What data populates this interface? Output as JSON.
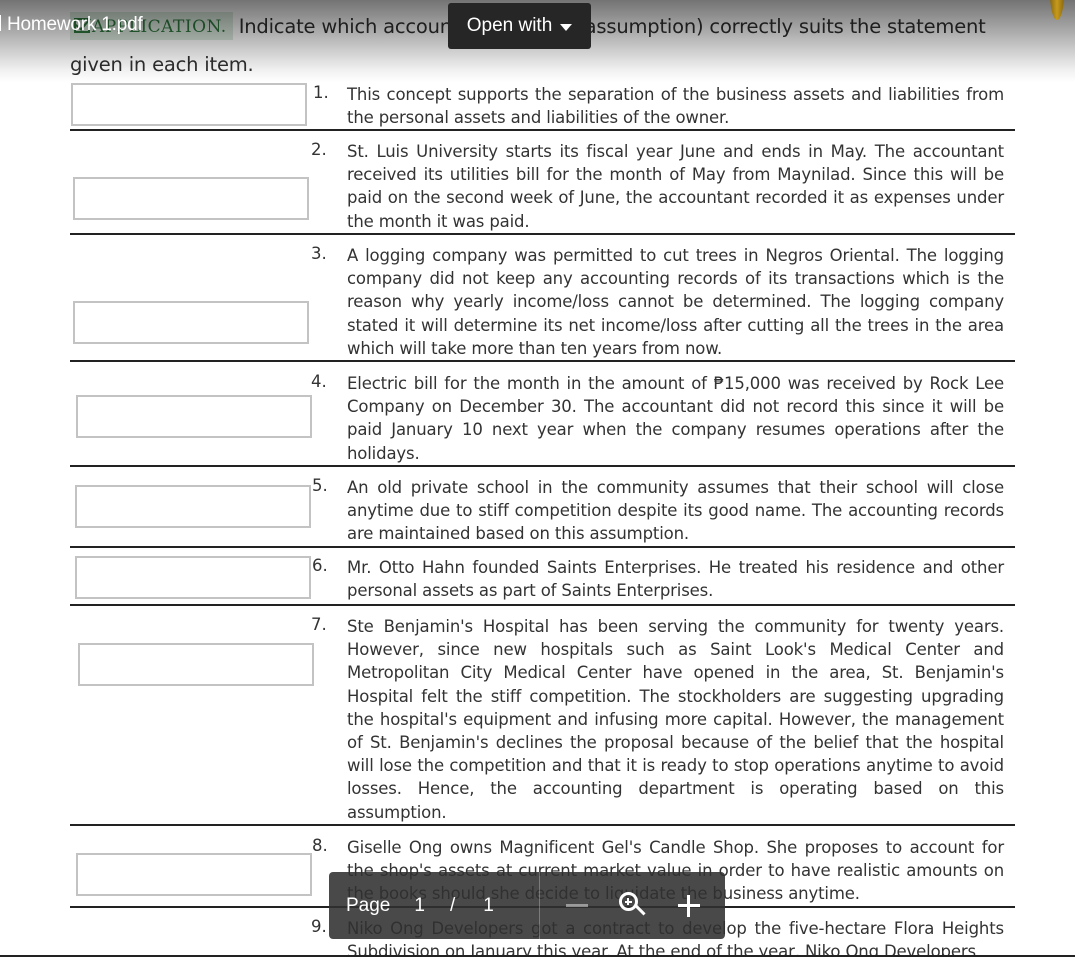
{
  "viewer": {
    "file_title": "Homework 1.pdf",
    "open_with_label": "Open with",
    "toolbar": {
      "page_label": "Page",
      "current_page": "1",
      "separator": "/",
      "total_pages": "1"
    }
  },
  "document": {
    "section_label": "APPLICATION.",
    "instructions_line1": "Indicate which accounting principle(assumption) correctly suits the statement",
    "instructions_line2": "given in each item.",
    "items": [
      {
        "number": "1.",
        "answer": "",
        "text": "This concept supports the separation of the business assets and liabilities from the personal assets and liabilities of the owner."
      },
      {
        "number": "2.",
        "answer": "",
        "text": "St. Luis University starts its fiscal year June and ends in May. The accountant received its utilities bill for the month of May from Maynilad. Since this will be paid on the second week of June, the accountant recorded it as expenses under the month it was paid."
      },
      {
        "number": "3.",
        "answer": "",
        "text": "A logging company was permitted to cut trees in Negros Oriental. The logging company did not keep any accounting records of its transactions which is the reason why yearly income/loss cannot be determined. The logging company stated it will determine its net income/loss after cutting all the trees in the area which will take more than ten years from now."
      },
      {
        "number": "4.",
        "answer": "",
        "text": "Electric bill for the month in the amount of ₱15,000 was received by Rock Lee Company on December 30. The accountant did not record this since it will be paid January 10 next year when the company resumes operations after the holidays."
      },
      {
        "number": "5.",
        "answer": "",
        "text": "An old private school in the community assumes that their school will close anytime due to stiff competition despite its good name. The accounting records are maintained based on this assumption."
      },
      {
        "number": "6.",
        "answer": "",
        "text": "Mr. Otto Hahn founded Saints Enterprises. He treated his residence and other personal assets as part of Saints Enterprises."
      },
      {
        "number": "7.",
        "answer": "",
        "text": "Ste Benjamin's Hospital has been serving the community for twenty years. However, since new hospitals such as Saint Look's Medical Center and Metropolitan City Medical Center have opened in the area, St. Benjamin's Hospital felt the stiff competition. The stockholders are suggesting upgrading the hospital's equipment and infusing more capital. However, the management of St. Benjamin's declines the proposal because of the belief that the hospital will lose the competition and that it is ready to stop operations anytime to avoid losses. Hence, the accounting department is operating based on this assumption."
      },
      {
        "number": "8.",
        "answer": "",
        "text": "Giselle Ong owns Magnificent Gel's Candle Shop. She proposes to account for the shop's assets at current market value in order to have realistic amounts on the books should she decide to liquidate the business anytime."
      },
      {
        "number": "9.",
        "answer": "",
        "text": "Niko Ong Developers got a contract to develop the five-hectare Flora Heights Subdivision on January this year. At the end of the year, Niko Ong Developers"
      }
    ]
  }
}
